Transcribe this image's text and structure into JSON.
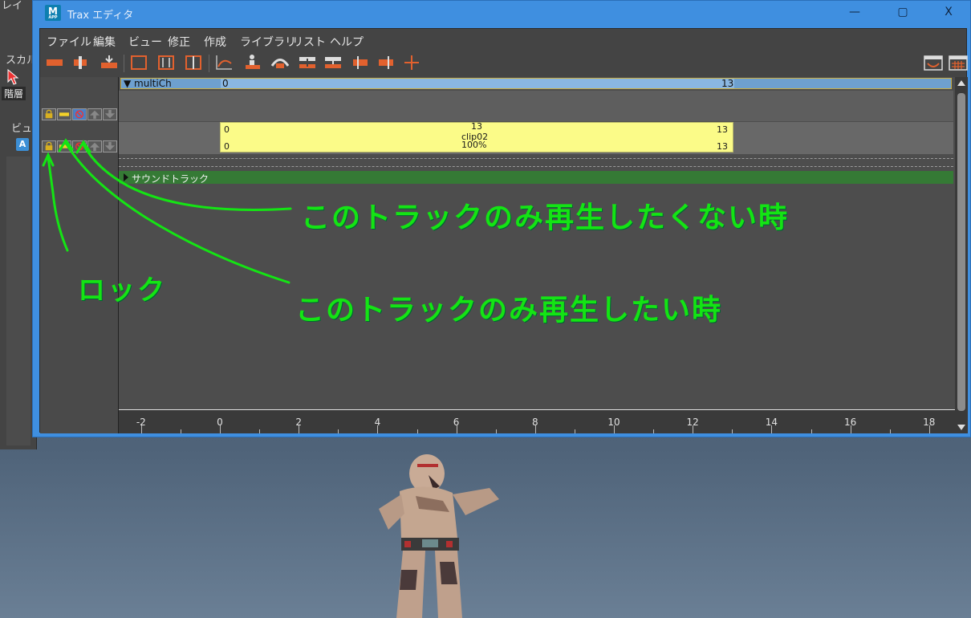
{
  "background_panel": {
    "fragment_top": "レイ",
    "fragment_skal": "スカル",
    "kaiso_label": "階層",
    "fragment_view": "ビュ",
    "a_icon_label": "A"
  },
  "window": {
    "app_icon_label": "M",
    "app_icon_sub": "APP",
    "title": "Trax エディタ",
    "minimize_glyph": "—",
    "maximize_glyph": "▢",
    "close_glyph": "X"
  },
  "menu": [
    "ファイル",
    "編集",
    "ビュー",
    "修正",
    "作成",
    "ライブラリ",
    "リスト",
    "ヘルプ"
  ],
  "character_set": {
    "name": "multiCh",
    "start": "0",
    "end": "13"
  },
  "clip": {
    "name": "clip02",
    "start_top": "0",
    "start_bottom": "0",
    "mid_top": "13",
    "end_top": "13",
    "end_bottom": "13",
    "scale": "100%"
  },
  "sound_track": {
    "label": "サウンドトラック"
  },
  "timeline": {
    "ticks": [
      "-2",
      "0",
      "2",
      "4",
      "6",
      "8",
      "10",
      "12",
      "14",
      "16",
      "18"
    ]
  },
  "annotations": {
    "mute": "このトラックのみ再生したくない時",
    "solo": "このトラックのみ再生したい時",
    "lock": "ロック"
  },
  "colors": {
    "annotation": "#14e414",
    "clip": "#fbfb88",
    "sound_track": "#357a35",
    "character_row": "#6ea0cf",
    "titlebar": "#3f8fe0"
  }
}
